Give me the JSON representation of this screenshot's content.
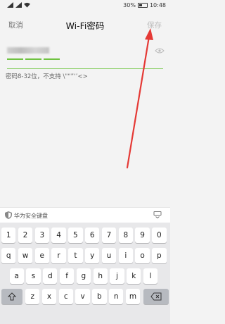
{
  "status": {
    "battery": "30%",
    "time": "10:48"
  },
  "header": {
    "cancel_label": "取消",
    "title": "Wi-Fi密码",
    "save_label": "保存"
  },
  "password": {
    "strength_segments": 3,
    "hint": "密码8-32位，不支持 \\\"“”‘’<>"
  },
  "keyboard": {
    "bar_label": "华为安全键盘",
    "row1": [
      "1",
      "2",
      "3",
      "4",
      "5",
      "6",
      "7",
      "8",
      "9",
      "0"
    ],
    "row2": [
      "q",
      "w",
      "e",
      "r",
      "t",
      "y",
      "u",
      "i",
      "o",
      "p"
    ],
    "row3": [
      "a",
      "s",
      "d",
      "f",
      "g",
      "h",
      "j",
      "k",
      "l"
    ],
    "row4": [
      "z",
      "x",
      "c",
      "v",
      "b",
      "n",
      "m"
    ]
  },
  "colors": {
    "accent": "#6fc241",
    "arrow": "#e53935"
  }
}
